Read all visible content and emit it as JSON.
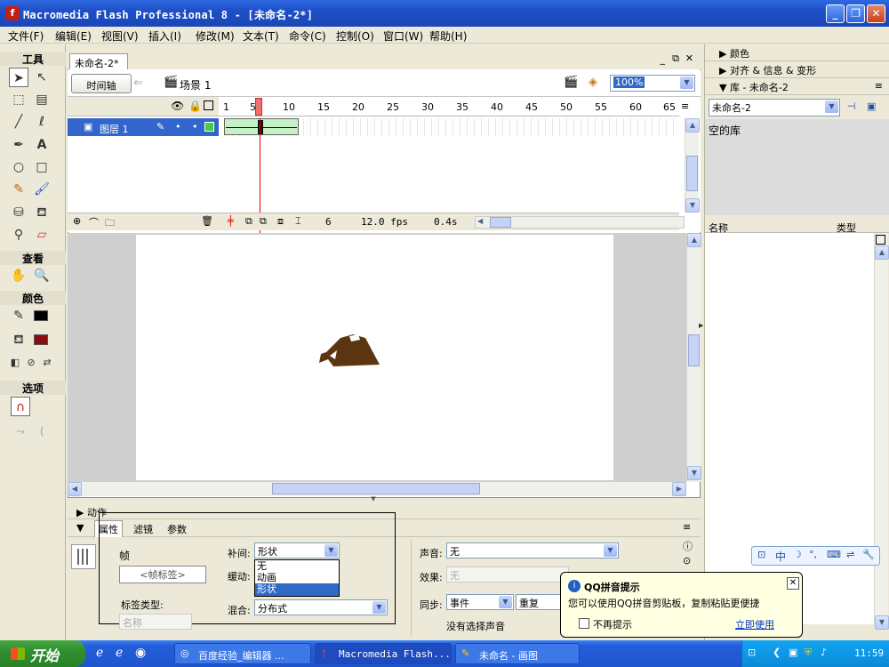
{
  "window": {
    "title": "Macromedia Flash Professional 8 - [未命名-2*]"
  },
  "menu": [
    "文件(F)",
    "编辑(E)",
    "视图(V)",
    "插入(I)",
    "修改(M)",
    "文本(T)",
    "命令(C)",
    "控制(O)",
    "窗口(W)",
    "帮助(H)"
  ],
  "toolbox": {
    "tools_title": "工具",
    "view_title": "查看",
    "colors_title": "颜色",
    "options_title": "选项",
    "stroke_color": "#000000",
    "fill_color": "#8B0E0E"
  },
  "document": {
    "tab": "未命名-2*",
    "timeline_button": "时间轴",
    "scene": "场景 1",
    "zoom": "100%"
  },
  "timeline": {
    "frame_numbers": [
      "1",
      "5",
      "10",
      "15",
      "20",
      "25",
      "30",
      "35",
      "40",
      "45",
      "50",
      "55",
      "60",
      "65"
    ],
    "layer_name": "图层 1",
    "current_frame": "6",
    "fps": "12.0 fps",
    "elapsed": "0.4s"
  },
  "stage": {
    "shape_color": "#5A3510"
  },
  "right_panel": {
    "color_panel": "颜色",
    "align_panel": "对齐 & 信息 & 变形",
    "library_panel": "库 - 未命名-2",
    "library_select": "未命名-2",
    "empty_library": "空的库",
    "col_name": "名称",
    "col_type": "类型"
  },
  "props": {
    "actions_panel": "动作",
    "tabs": [
      "属性",
      "滤镜",
      "参数"
    ],
    "frame_label": "帧",
    "frame_label_input": "<帧标签>",
    "label_type_label": "标签类型:",
    "label_type_value": "名称",
    "tween_label": "补间:",
    "tween_value": "形状",
    "tween_options": [
      "无",
      "动画",
      "形状"
    ],
    "ease_label": "缓动:",
    "blend_label": "混合:",
    "blend_value": "分布式",
    "sound_label": "声音:",
    "sound_value": "无",
    "effect_label": "效果:",
    "effect_value": "无",
    "sync_label": "同步:",
    "sync_value": "事件",
    "repeat_value": "重复",
    "no_sound": "没有选择声音"
  },
  "balloon": {
    "title": "QQ拼音提示",
    "text": "您可以使用QQ拼音剪贴板，复制粘贴更便捷",
    "checkbox": "不再提示",
    "link": "立即使用"
  },
  "ime_bar": {
    "mode": "中"
  },
  "taskbar": {
    "start": "开始",
    "tasks": [
      "百度经验_编辑器 ...",
      "Macromedia Flash...",
      "未命名 - 画图"
    ],
    "clock": "11:59"
  }
}
